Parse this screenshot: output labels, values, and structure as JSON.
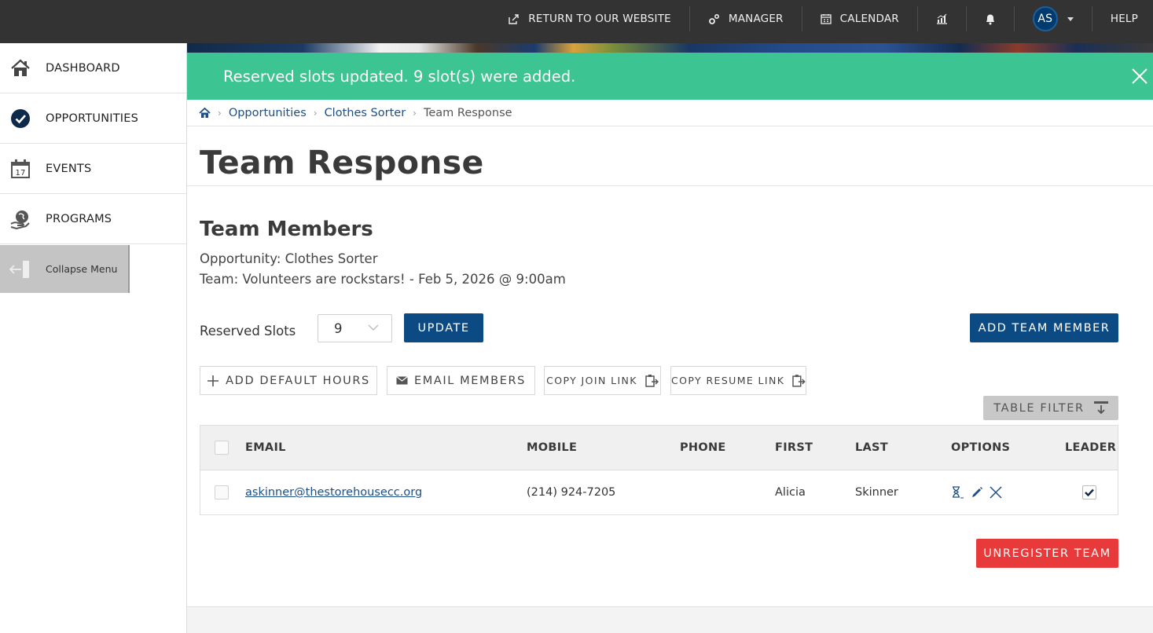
{
  "topnav": {
    "return_label": "RETURN TO OUR WEBSITE",
    "manager_label": "MANAGER",
    "calendar_label": "CALENDAR",
    "avatar_initials": "AS",
    "help_label": "HELP"
  },
  "sidebar": {
    "items": [
      {
        "label": "DASHBOARD",
        "icon": "home-icon"
      },
      {
        "label": "OPPORTUNITIES",
        "icon": "check-circle-icon"
      },
      {
        "label": "EVENTS",
        "icon": "calendar-17-icon"
      },
      {
        "label": "PROGRAMS",
        "icon": "globe-hand-icon"
      }
    ],
    "collapse_label": "Collapse Menu",
    "calendar_day": "17"
  },
  "alert": {
    "message": "Reserved slots updated. 9 slot(s) were added.",
    "color": "#3cc492"
  },
  "breadcrumb": {
    "items": [
      "Opportunities",
      "Clothes Sorter"
    ],
    "current": "Team Response"
  },
  "page": {
    "title": "Team Response"
  },
  "team": {
    "section_title": "Team Members",
    "opportunity": "Opportunity: Clothes Sorter",
    "team_line": "Team: Volunteers are rockstars! - Feb 5, 2026 @ 9:00am",
    "reserved_slots_label": "Reserved Slots",
    "reserved_slots_value": "9",
    "update_label": "UPDATE",
    "add_member_label": "ADD TEAM MEMBER",
    "add_default_hours_label": "ADD DEFAULT HOURS",
    "email_members_label": "EMAIL MEMBERS",
    "copy_join_link_label": "COPY JOIN LINK",
    "copy_resume_link_label": "COPY RESUME LINK",
    "table_filter_label": "TABLE FILTER",
    "unregister_label": "UNREGISTER TEAM"
  },
  "table": {
    "columns": [
      "EMAIL",
      "MOBILE",
      "PHONE",
      "FIRST",
      "LAST",
      "OPTIONS",
      "LEADER"
    ],
    "rows": [
      {
        "email": "askinner@thestorehousecc.org",
        "mobile": "(214) 924-7205",
        "phone": "",
        "first": "Alicia",
        "last": "Skinner",
        "leader": true
      }
    ]
  },
  "colors": {
    "primary": "#0b4a82",
    "danger": "#e83a3a",
    "topbar": "#333333",
    "link": "#1d4e86"
  }
}
